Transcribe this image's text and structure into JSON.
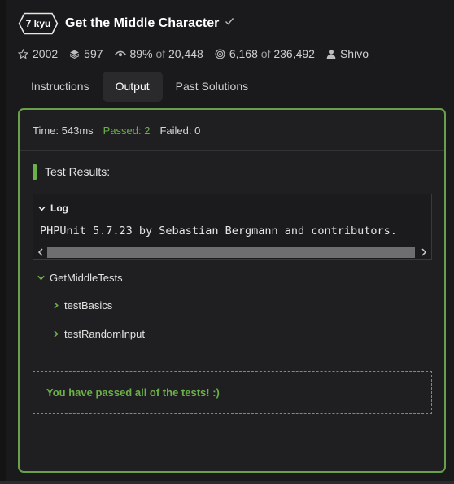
{
  "header": {
    "rank": "7 kyu",
    "title": "Get the Middle Character"
  },
  "stats": {
    "stars": "2002",
    "collections": "597",
    "satisfaction_percent": "89%",
    "satisfaction_of": "of",
    "satisfaction_votes": "20,448",
    "completed": "6,168",
    "completed_of": "of",
    "completed_total": "236,492",
    "author": "Shivo"
  },
  "tabs": [
    {
      "label": "Instructions",
      "active": false
    },
    {
      "label": "Output",
      "active": true
    },
    {
      "label": "Past Solutions",
      "active": false
    }
  ],
  "summary": {
    "time": "Time: 543ms",
    "passed": "Passed: 2",
    "failed": "Failed: 0"
  },
  "results": {
    "heading": "Test Results:",
    "log_label": "Log",
    "log_text": "PHPUnit 5.7.23 by Sebastian Bergmann and contributors.",
    "root": "GetMiddleTests",
    "children": [
      "testBasics",
      "testRandomInput"
    ],
    "pass_message": "You have passed all of the tests! :)"
  },
  "colors": {
    "accent_green": "#6cb049",
    "panel_border": "#6ba04a",
    "background": "#1a1a1c"
  },
  "icons": {
    "rank": "hexagon-badge",
    "title_check": "check-icon",
    "stars": "star-icon",
    "collections": "stack-icon",
    "satisfaction": "eye-icon",
    "completed": "target-icon",
    "author": "user-icon",
    "log": "chevron-down-icon",
    "tree_root": "chevron-down-icon",
    "tree_child": "chevron-right-icon"
  }
}
